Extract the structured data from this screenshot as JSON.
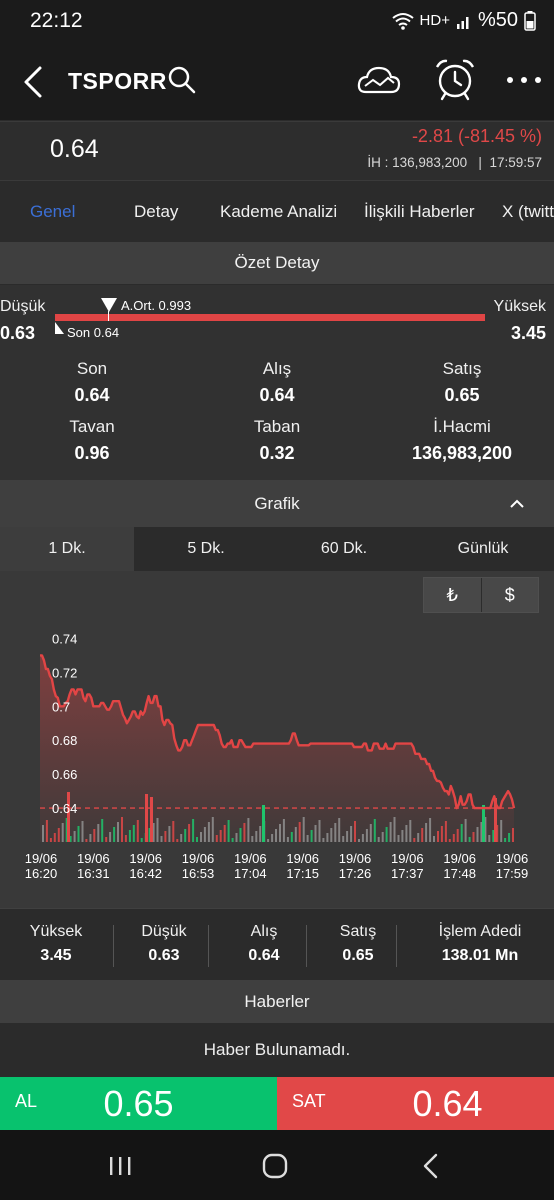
{
  "status": {
    "time": "22:12",
    "network": "HD+",
    "battery": "%50",
    "icons": [
      "wifi-icon",
      "signal-icon",
      "battery-icon"
    ]
  },
  "header": {
    "symbol": "TSPORR",
    "icons": [
      "back-icon",
      "search-icon",
      "cloud-chart-icon",
      "alarm-clock-icon",
      "more-icon"
    ]
  },
  "price": {
    "last": "0.64",
    "change": "-2.81 (-81.45 %)",
    "volume": "İH : 136,983,200",
    "time": "17:59:57",
    "change_color": "#e04848"
  },
  "tabs": [
    {
      "label": "Genel",
      "active": true
    },
    {
      "label": "Detay"
    },
    {
      "label": "Kademe Analizi"
    },
    {
      "label": "İlişkili Haberler"
    },
    {
      "label": "X (twitt"
    }
  ],
  "summary": {
    "title": "Özet Detay",
    "low_label": "Düşük",
    "low_value": "0.63",
    "high_label": "Yüksek",
    "high_value": "3.45",
    "avg_label": "A.Ort. 0.993",
    "last_label": "Son 0.64",
    "stats": [
      {
        "label": "Son",
        "value": "0.64"
      },
      {
        "label": "Alış",
        "value": "0.64"
      },
      {
        "label": "Satış",
        "value": "0.65"
      },
      {
        "label": "Tavan",
        "value": "0.96"
      },
      {
        "label": "Taban",
        "value": "0.32"
      },
      {
        "label": "İ.Hacmi",
        "value": "136,983,200"
      }
    ]
  },
  "grafik": {
    "title": "Grafik",
    "periods": [
      {
        "label": "1 Dk.",
        "active": true
      },
      {
        "label": "5 Dk."
      },
      {
        "label": "60 Dk."
      },
      {
        "label": "Günlük"
      }
    ],
    "currencies": [
      "₺",
      "$"
    ]
  },
  "chart_data": {
    "type": "line",
    "title": "",
    "xlabel": "",
    "ylabel": "",
    "y_ticks": [
      "0.74",
      "0.72",
      "0.7",
      "0.68",
      "0.66",
      "0.64"
    ],
    "ylim": [
      0.62,
      0.745
    ],
    "reference_line": 0.64,
    "x_ticks": [
      [
        "19/06",
        "16:20"
      ],
      [
        "19/06",
        "16:31"
      ],
      [
        "19/06",
        "16:42"
      ],
      [
        "19/06",
        "16:53"
      ],
      [
        "19/06",
        "17:04"
      ],
      [
        "19/06",
        "17:15"
      ],
      [
        "19/06",
        "17:26"
      ],
      [
        "19/06",
        "17:37"
      ],
      [
        "19/06",
        "17:48"
      ],
      [
        "19/06",
        "17:59"
      ]
    ],
    "series": [
      {
        "values": [
          0.73,
          0.73,
          0.727,
          0.722,
          0.722,
          0.718,
          0.716,
          0.71,
          0.706,
          0.705,
          0.7,
          0.7,
          0.7,
          0.702,
          0.703,
          0.707,
          0.71,
          0.71,
          0.707,
          0.71,
          0.71,
          0.71,
          0.705,
          0.703,
          0.707,
          0.707,
          0.705,
          0.7,
          0.7,
          0.7,
          0.7,
          0.702,
          0.702,
          0.7,
          0.698,
          0.698,
          0.7,
          0.703,
          0.703,
          0.703,
          0.703,
          0.699,
          0.695,
          0.693,
          0.69,
          0.692,
          0.694,
          0.697,
          0.697,
          0.694,
          0.693,
          0.697,
          0.695,
          0.697,
          0.702,
          0.706,
          0.702,
          0.702,
          0.706,
          0.706,
          0.7,
          0.7,
          0.692,
          0.689,
          0.692,
          0.692,
          0.69,
          0.689,
          0.681,
          0.677,
          0.674,
          0.674,
          0.676,
          0.68,
          0.68,
          0.677,
          0.677,
          0.68,
          0.683,
          0.686,
          0.689,
          0.689,
          0.689,
          0.689,
          0.689,
          0.689,
          0.689,
          0.689,
          0.689,
          0.686,
          0.686,
          0.683,
          0.678,
          0.676,
          0.676,
          0.678,
          0.678,
          0.68,
          0.676,
          0.676,
          0.676,
          0.68,
          0.68,
          0.678,
          0.676,
          0.676,
          0.676,
          0.676,
          0.678,
          0.678,
          0.678,
          0.678,
          0.678,
          0.678,
          0.678,
          0.678,
          0.678,
          0.678,
          0.678,
          0.678,
          0.678,
          0.678,
          0.678,
          0.678,
          0.678,
          0.678,
          0.678,
          0.68,
          0.684,
          0.684,
          0.68,
          0.677,
          0.677,
          0.677,
          0.677,
          0.677,
          0.677,
          0.678,
          0.678,
          0.678,
          0.678,
          0.678,
          0.678,
          0.678,
          0.678,
          0.678,
          0.678,
          0.678,
          0.678,
          0.678,
          0.678,
          0.678,
          0.678,
          0.678,
          0.678,
          0.678,
          0.678,
          0.678,
          0.678,
          0.676,
          0.676,
          0.676,
          0.676,
          0.676,
          0.678,
          0.678,
          0.674,
          0.674,
          0.674,
          0.678,
          0.678,
          0.678,
          0.675,
          0.675,
          0.675,
          0.678,
          0.675,
          0.675,
          0.675,
          0.675,
          0.678,
          0.678,
          0.678,
          0.678,
          0.678,
          0.678,
          0.678,
          0.678,
          0.678,
          0.676,
          0.672,
          0.672,
          0.672,
          0.669,
          0.669,
          0.669,
          0.666,
          0.666,
          0.662,
          0.662,
          0.658,
          0.656,
          0.656,
          0.655,
          0.652,
          0.65,
          0.65,
          0.648,
          0.653,
          0.65,
          0.646,
          0.64,
          0.642,
          0.647,
          0.642,
          0.642,
          0.644,
          0.648,
          0.648,
          0.642,
          0.64,
          0.64,
          0.64,
          0.64,
          0.64,
          0.64,
          0.64,
          0.64,
          0.64,
          0.644,
          0.647,
          0.642,
          0.64,
          0.64,
          0.644,
          0.646,
          0.648,
          0.65,
          0.648,
          0.645,
          0.64
        ]
      }
    ],
    "volume_colors": {
      "up": "#1fc46c",
      "down": "#e04848",
      "neutral": "#909090"
    },
    "grid": false
  },
  "bottom_stats": [
    {
      "label": "Yüksek",
      "value": "3.45"
    },
    {
      "label": "Düşük",
      "value": "0.63"
    },
    {
      "label": "Alış",
      "value": "0.64"
    },
    {
      "label": "Satış",
      "value": "0.65"
    },
    {
      "label": "İşlem Adedi",
      "value": "138.01 Mn"
    }
  ],
  "news": {
    "title": "Haberler",
    "empty": "Haber Bulunamadı."
  },
  "trade": {
    "buy_label": "AL",
    "buy_price": "0.65",
    "sell_label": "SAT",
    "sell_price": "0.64",
    "buy_color": "#08c26e",
    "sell_color": "#e14848"
  },
  "navbar": {
    "icons": [
      "recent-apps-icon",
      "home-icon",
      "back-nav-icon"
    ]
  }
}
